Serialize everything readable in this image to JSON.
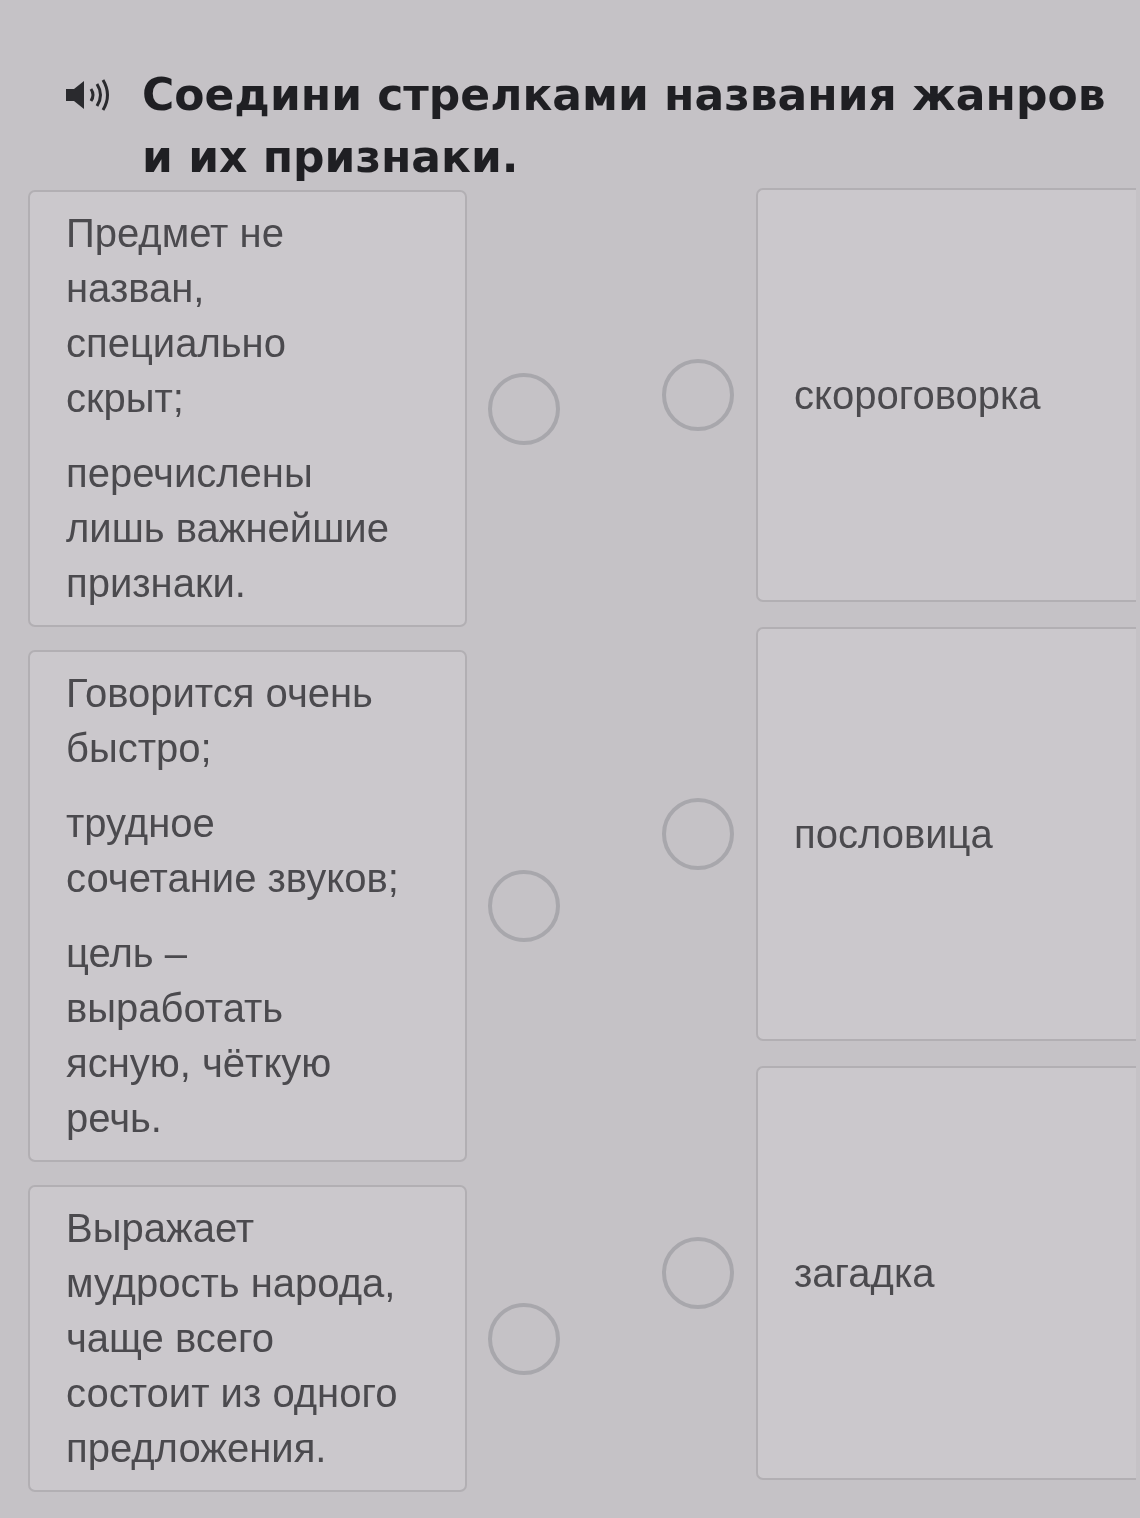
{
  "instruction": {
    "text": "Соедини стрелками названия жанров и их признаки."
  },
  "features": [
    {
      "paragraphs": [
        "Предмет не назван, специально скрыт;",
        "перечислены лишь важнейшие признаки."
      ]
    },
    {
      "paragraphs": [
        "Говорится очень быстро;",
        "трудное сочетание звуков;",
        "цель – выработать ясную, чёткую речь."
      ]
    },
    {
      "paragraphs": [
        "Выражает мудрость народа, чаще всего состоит из одного предложения."
      ]
    }
  ],
  "genres": [
    {
      "label": "скороговорка"
    },
    {
      "label": "пословица"
    },
    {
      "label": "загадка"
    }
  ]
}
